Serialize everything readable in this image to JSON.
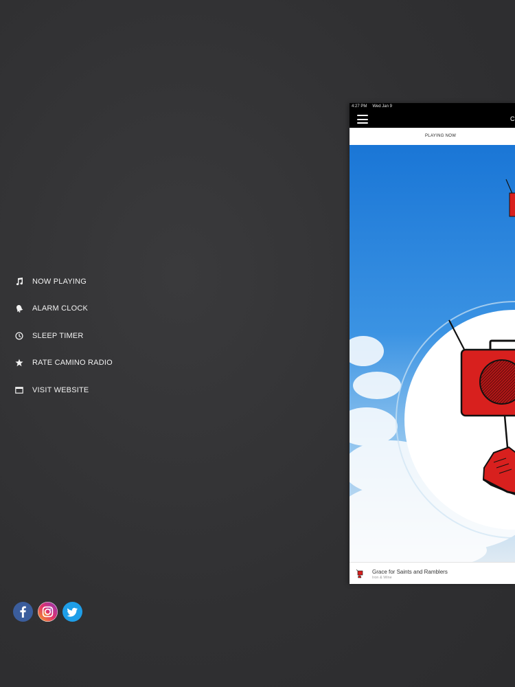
{
  "menu": {
    "items": [
      {
        "label": "NOW PLAYING",
        "icon": "music-note-icon"
      },
      {
        "label": "ALARM CLOCK",
        "icon": "alarm-bell-icon"
      },
      {
        "label": "SLEEP TIMER",
        "icon": "clock-icon"
      },
      {
        "label": "RATE CAMINO RADIO",
        "icon": "star-icon"
      },
      {
        "label": "VISIT WEBSITE",
        "icon": "browser-window-icon"
      }
    ]
  },
  "social": [
    {
      "name": "facebook",
      "icon": "facebook-icon",
      "color": "#3b5d9c"
    },
    {
      "name": "instagram",
      "icon": "instagram-icon",
      "color": "#c1307d"
    },
    {
      "name": "twitter",
      "icon": "twitter-icon",
      "color": "#1e9ee8"
    }
  ],
  "device": {
    "status": {
      "time": "4:27 PM",
      "date": "Wed Jan 9"
    },
    "nav_title": "C",
    "tab_label": "PLAYING NOW",
    "now_playing": {
      "song": "Grace for Saints and Ramblers",
      "artist": "Iron & Wine"
    }
  },
  "colors": {
    "background": "#323234",
    "accent_red": "#d8201e",
    "sky_blue": "#1f7fd9"
  }
}
